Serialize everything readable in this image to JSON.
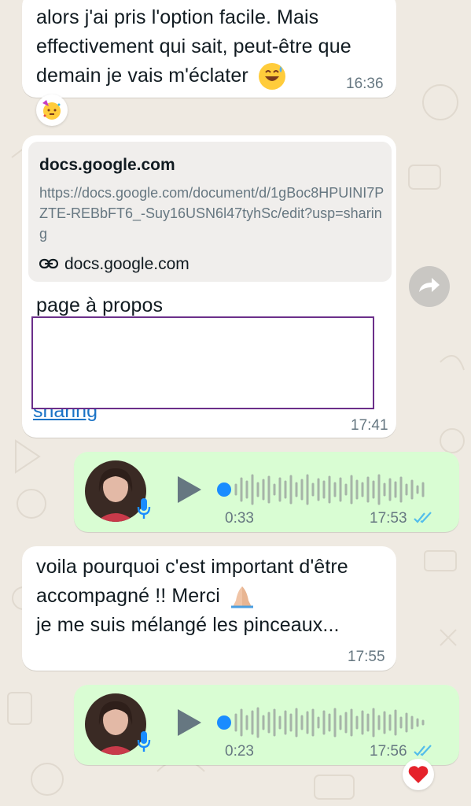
{
  "messages": {
    "m1": {
      "text_line1": "alors j'ai pris l'option facile. Mais",
      "text_line2": "effectivement qui sait, peut-être que",
      "text_line3": "demain je vais m'éclater",
      "time": "16:36",
      "emoji": "grinning-sweat-emoji",
      "reaction": "party-face-emoji"
    },
    "m2": {
      "link_preview": {
        "domain": "docs.google.com",
        "url": "https://docs.google.com/document/d/1gBoc8HPUINI7PZTE-REBbFT6_-Suy16USN6l47tyhSc/edit?usp=sharing",
        "footer": "docs.google.com"
      },
      "text": "page à propos",
      "link_tail": "sharing",
      "time": "17:41"
    },
    "m3": {
      "duration": "0:33",
      "time": "17:53"
    },
    "m4": {
      "text_line1": "voila pourquoi c'est important d'être",
      "text_line2": "accompagné !! Merci",
      "text_line3": "je me suis mélangé les pinceaux...",
      "time": "17:55",
      "emoji": "folded-hands-emoji"
    },
    "m5": {
      "duration": "0:23",
      "time": "17:56",
      "reaction": "red-heart-emoji"
    }
  },
  "colors": {
    "incoming": "#ffffff",
    "outgoing": "#d9fdd3",
    "read_ticks": "#53bdeb",
    "link": "#1a73c6",
    "accent_dot": "#1a8cff"
  }
}
